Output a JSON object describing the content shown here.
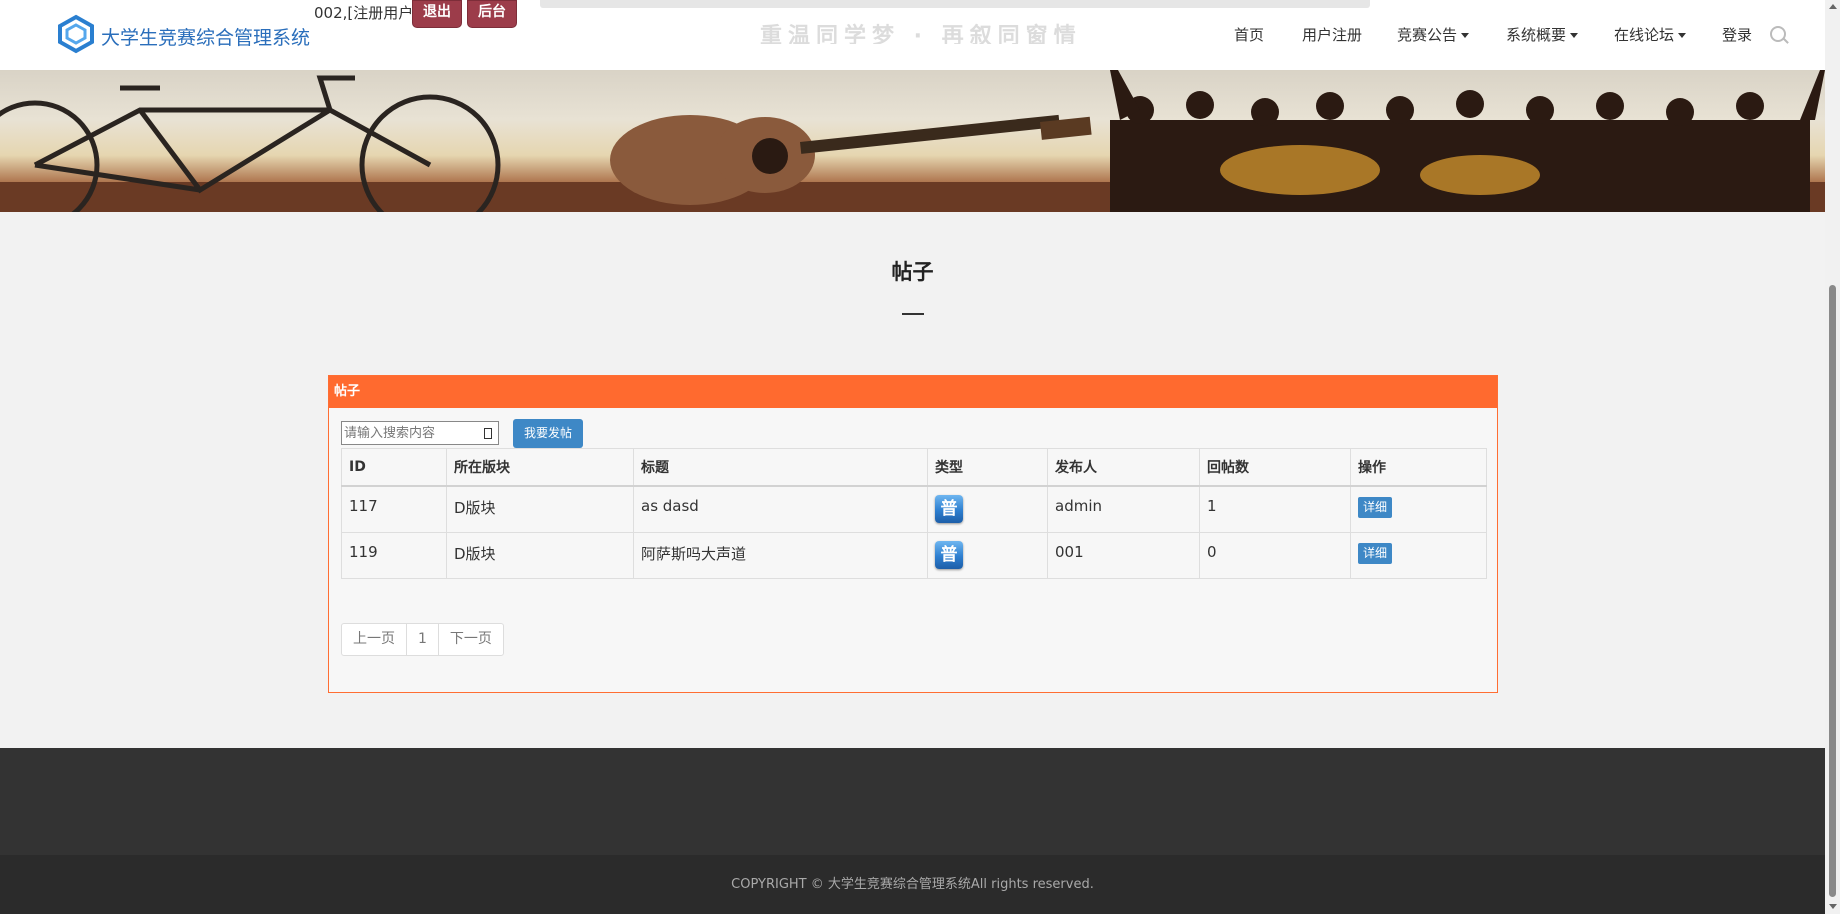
{
  "header": {
    "site_title": "大学生竞赛综合管理系统",
    "user_info": "002,[注册用户]",
    "logout_label": "退出",
    "admin_label": "后台",
    "banner_slogan": "重温同学梦 · 再叙同窗情",
    "nav": {
      "home": "首页",
      "register": "用户注册",
      "announcements": "竞赛公告",
      "overview": "系统概要",
      "forum": "在线论坛",
      "login": "登录"
    }
  },
  "section": {
    "title": "帖子"
  },
  "panel": {
    "heading": "帖子",
    "search_placeholder": "请输入搜索内容",
    "post_button": "我要发帖",
    "columns": {
      "id": "ID",
      "board": "所在版块",
      "title": "标题",
      "type": "类型",
      "author": "发布人",
      "replies": "回帖数",
      "action": "操作"
    },
    "rows": [
      {
        "id": "117",
        "board": "D版块",
        "title": "as dasd",
        "type": "普",
        "author": "admin",
        "replies": "1",
        "action": "详细"
      },
      {
        "id": "119",
        "board": "D版块",
        "title": "阿萨斯吗大声道",
        "type": "普",
        "author": "001",
        "replies": "0",
        "action": "详细"
      }
    ],
    "pagination": {
      "prev": "上一页",
      "page": "1",
      "next": "下一页"
    }
  },
  "footer": {
    "copyright": "COPYRIGHT © 大学生竞赛综合管理系统All rights reserved."
  },
  "colors": {
    "accent": "#ff6a2f",
    "primary_button": "#3e88c6",
    "auth_button": "#9c3c4a",
    "link_blue": "#2a6ebb"
  },
  "icons": {
    "logo": "hexagon-logo-icon",
    "search": "search-icon",
    "dropdown": "caret-down-icon",
    "type": "normal-post-icon"
  }
}
